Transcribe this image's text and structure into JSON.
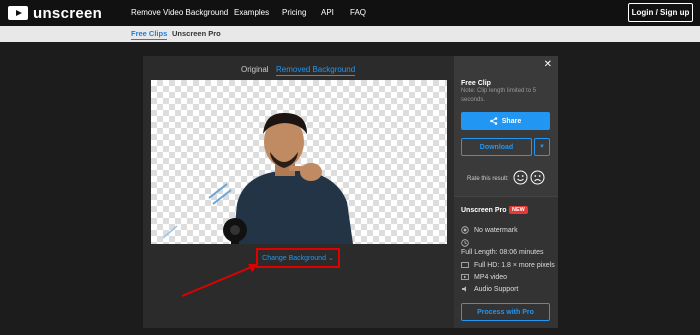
{
  "nav": {
    "brand": "unscreen",
    "links": [
      "Remove Video Background",
      "Examples",
      "Pricing",
      "API",
      "FAQ"
    ],
    "login": "Login / Sign up"
  },
  "subnav": {
    "items": [
      "Free Clips",
      "Unscreen Pro"
    ]
  },
  "editor": {
    "tabs": [
      "Original",
      "Removed Background"
    ],
    "change_background": "Change Background"
  },
  "free_clip": {
    "title": "Free Clip",
    "note": "Note: Clip length limited to 5 seconds.",
    "share": "Share",
    "download": "Download",
    "rate_label": "Rate this result:"
  },
  "pro": {
    "title": "Unscreen Pro",
    "badge": "NEW",
    "features": [
      "No watermark",
      "Full Length: 08:06 minutes",
      "Full HD: 1.8 × more pixels",
      "MP4 video",
      "Audio Support"
    ],
    "cta": "Process with Pro"
  },
  "colors": {
    "accent": "#2196f3",
    "highlight": "#e00000",
    "badge": "#e53935"
  }
}
